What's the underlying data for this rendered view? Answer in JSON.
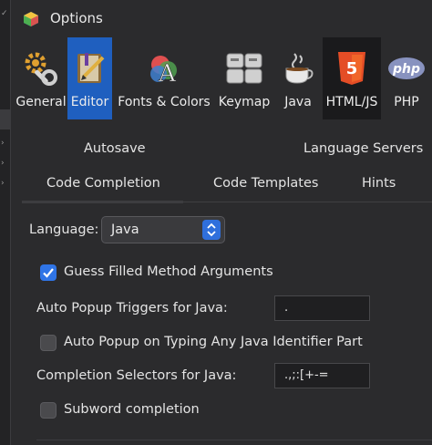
{
  "dialog": {
    "title": "Options"
  },
  "categories": [
    {
      "label": "General",
      "icon": "gears-icon"
    },
    {
      "label": "Editor",
      "icon": "editor-book-icon",
      "active": true
    },
    {
      "label": "Fonts & Colors",
      "icon": "fonts-colors-icon"
    },
    {
      "label": "Keymap",
      "icon": "keyboard-icon"
    },
    {
      "label": "Java",
      "icon": "java-cup-icon"
    },
    {
      "label": "HTML/JS",
      "icon": "html5-icon"
    },
    {
      "label": "PHP",
      "icon": "php-icon"
    }
  ],
  "tabs": {
    "row1": [
      "Autosave",
      "Language Servers"
    ],
    "row2": [
      "Code Completion",
      "Code Templates",
      "Hints"
    ],
    "selected": "Code Completion"
  },
  "completion": {
    "language_label": "Language:",
    "language_value": "Java",
    "guess_args_label": "Guess Filled Method Arguments",
    "guess_args_checked": true,
    "popup_triggers_label": "Auto Popup Triggers for Java:",
    "popup_triggers_value": ".",
    "popup_typing_label": "Auto Popup on Typing Any Java Identifier Part",
    "popup_typing_checked": false,
    "selectors_label": "Completion Selectors for Java:",
    "selectors_value": ".,;:[+-=",
    "subword_label": "Subword completion",
    "subword_checked": false
  },
  "colors": {
    "accent": "#1f5fbf",
    "checkbox_on": "#2f74e6"
  }
}
